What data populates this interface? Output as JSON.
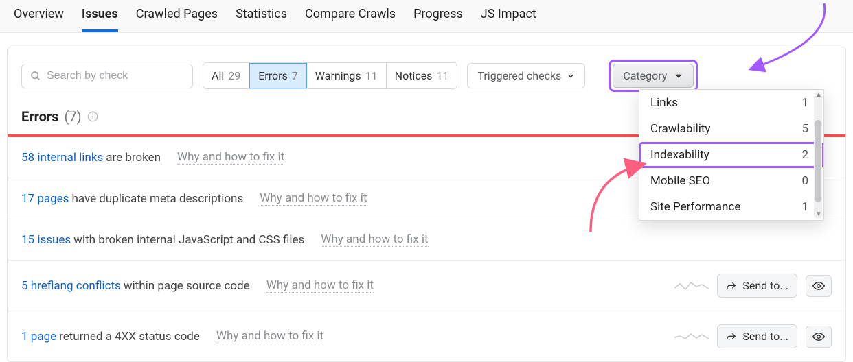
{
  "nav": {
    "tabs": [
      "Overview",
      "Issues",
      "Crawled Pages",
      "Statistics",
      "Compare Crawls",
      "Progress",
      "JS Impact"
    ],
    "active_index": 1
  },
  "toolbar": {
    "search_placeholder": "Search by check",
    "filters": [
      {
        "label": "All",
        "count": 29
      },
      {
        "label": "Errors",
        "count": 7
      },
      {
        "label": "Warnings",
        "count": 11
      },
      {
        "label": "Notices",
        "count": 11
      }
    ],
    "active_filter_index": 1,
    "triggered_label": "Triggered checks",
    "category_label": "Category"
  },
  "section": {
    "title": "Errors",
    "count_display": "(7)"
  },
  "issues": [
    {
      "link": "58 internal links",
      "text": "are broken",
      "fix": "Why and how to fix it"
    },
    {
      "link": "17 pages",
      "text": "have duplicate meta descriptions",
      "fix": "Why and how to fix it"
    },
    {
      "link": "15 issues",
      "text": "with broken internal JavaScript and CSS files",
      "fix": "Why and how to fix it"
    },
    {
      "link": "5 hreflang conflicts",
      "text": "within page source code",
      "fix": "Why and how to fix it"
    },
    {
      "link": "1 page",
      "text": "returned a 4XX status code",
      "fix": "Why and how to fix it"
    }
  ],
  "row_actions": {
    "send": "Send to..."
  },
  "categories": [
    {
      "label": "Links",
      "count": 1
    },
    {
      "label": "Crawlability",
      "count": 5
    },
    {
      "label": "Indexability",
      "count": 2,
      "highlight": true
    },
    {
      "label": "Mobile SEO",
      "count": 0
    },
    {
      "label": "Site Performance",
      "count": 1
    }
  ],
  "annotation_colors": {
    "purple": "#a259ff",
    "red": "#ff5f7e"
  }
}
